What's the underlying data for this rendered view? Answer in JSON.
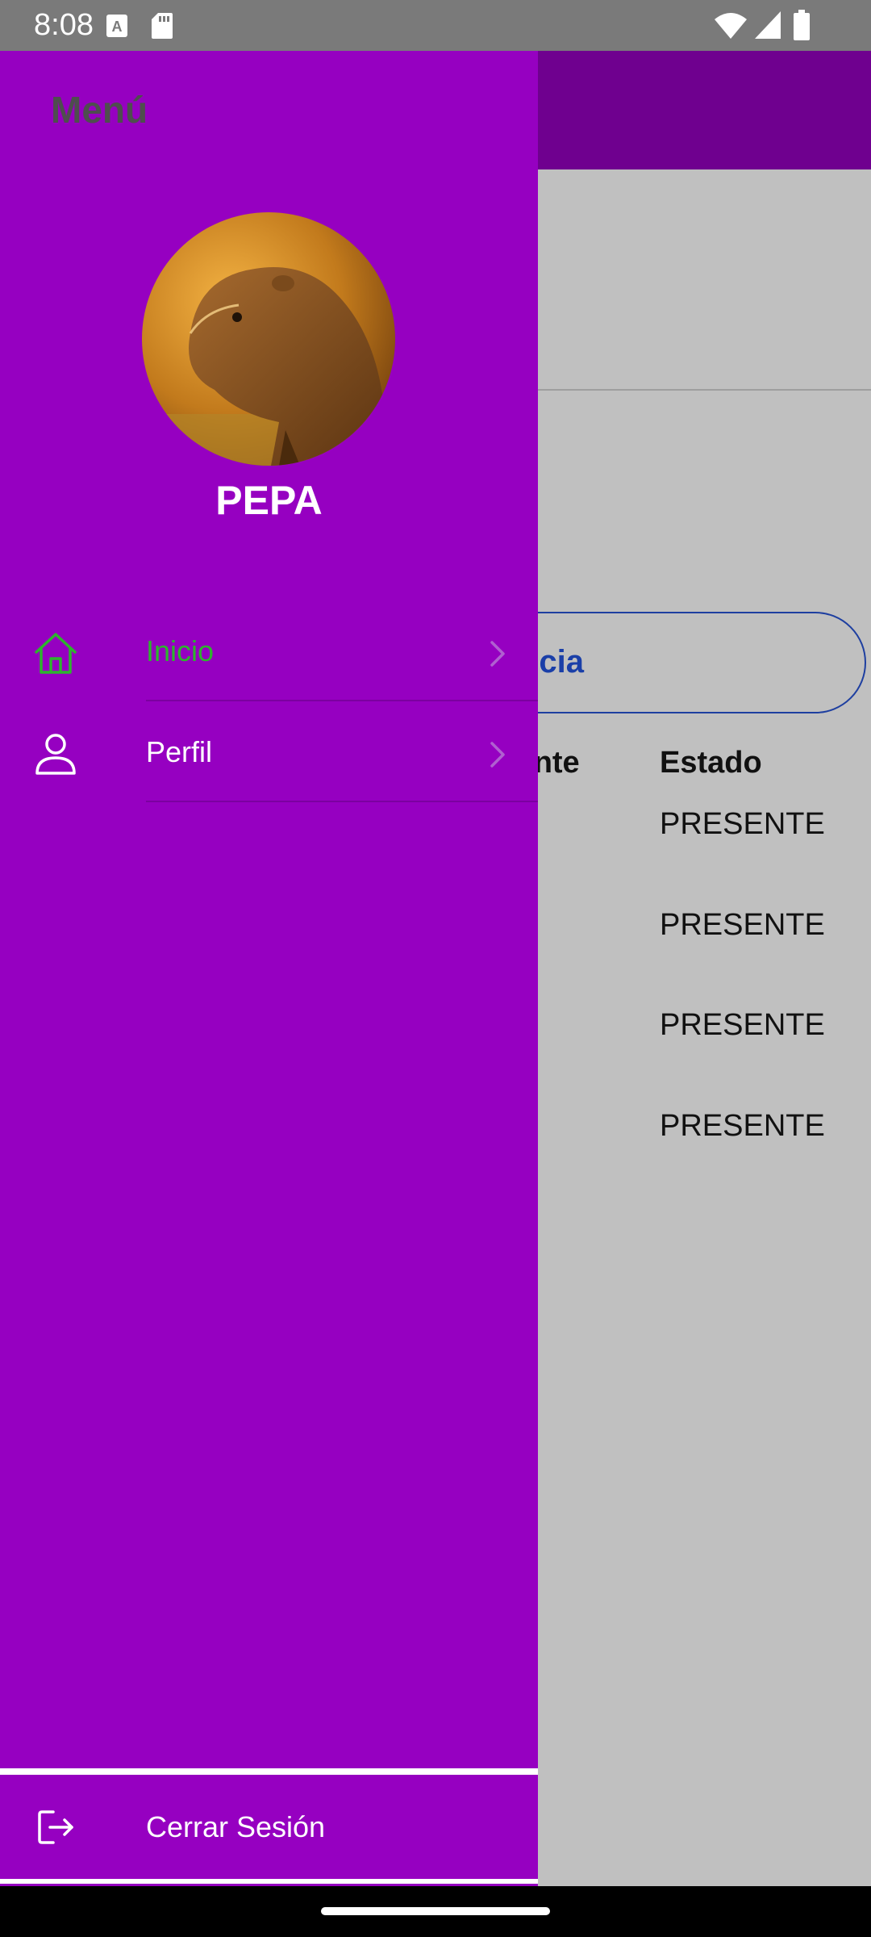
{
  "status_bar": {
    "time": "8:08",
    "icons": [
      "a-icon",
      "sd-card-icon",
      "wifi-icon",
      "signal-icon",
      "battery-icon"
    ]
  },
  "background": {
    "button_label": "ncia",
    "columns": {
      "student_fragment": "iante",
      "estado": "Estado"
    },
    "estado_values": [
      "PRESENTE",
      "PRESENTE",
      "PRESENTE",
      "PRESENTE"
    ]
  },
  "drawer": {
    "title": "Menú",
    "username": "PEPA",
    "items": [
      {
        "label": "Inicio",
        "icon": "home-icon",
        "active": true,
        "color": "#2db52d"
      },
      {
        "label": "Perfil",
        "icon": "person-icon",
        "active": false,
        "color": "#ffffff"
      }
    ],
    "logout_label": "Cerrar Sesión",
    "colors": {
      "drawer_bg": "#9600c1",
      "app_bar": "#6f008f",
      "active": "#2db52d",
      "title": "#4e4e4e"
    }
  }
}
